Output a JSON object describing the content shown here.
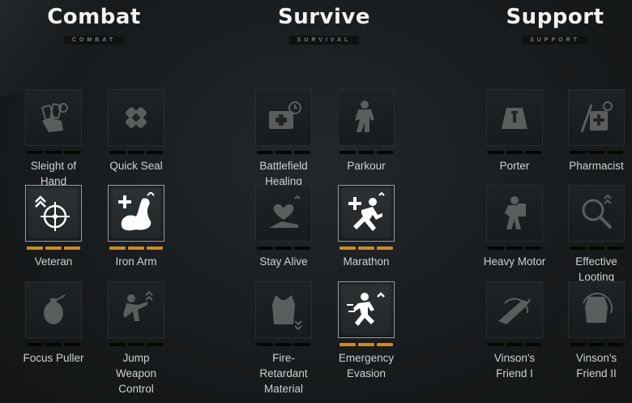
{
  "columns": [
    {
      "title": "Combat",
      "subtitle": "COMBAT"
    },
    {
      "title": "Survive",
      "subtitle": "SURVIVAL"
    },
    {
      "title": "Support",
      "subtitle": "SUPPORT"
    }
  ],
  "colors": {
    "active_bar": "#c98a2e",
    "inactive_bar": "#050606"
  },
  "perks": {
    "sleight_of_hand": {
      "label": "Sleight of\nHand",
      "icon": "hand-cards-icon",
      "active": false
    },
    "quick_seal": {
      "label": "Quick Seal",
      "icon": "bandage-icon",
      "active": false
    },
    "veteran": {
      "label": "Veteran",
      "icon": "crosshair-chevrons-icon",
      "active": true
    },
    "iron_arm": {
      "label": "Iron Arm",
      "icon": "flexed-arm-icon",
      "active": true
    },
    "focus_puller": {
      "label": "Focus Puller",
      "icon": "grenade-hand-icon",
      "active": false
    },
    "jump_weapon_control": {
      "label": "Jump\nWeapon\nControl",
      "icon": "jumping-soldier-icon",
      "active": false
    },
    "battlefield_healing": {
      "label": "Battlefield\nHealing",
      "icon": "medkit-timer-icon",
      "active": false
    },
    "parkour": {
      "label": "Parkour",
      "icon": "climbing-soldier-icon",
      "active": false
    },
    "stay_alive": {
      "label": "Stay Alive",
      "icon": "wounded-heart-icon",
      "active": false
    },
    "marathon": {
      "label": "Marathon",
      "icon": "running-man-icon",
      "active": true
    },
    "fire_retardant_material": {
      "label": "Fire-\nRetardant\nMaterial",
      "icon": "vest-icon",
      "active": false
    },
    "emergency_evasion": {
      "label": "Emergency\nEvasion",
      "icon": "sprinting-man-icon",
      "active": true
    },
    "porter": {
      "label": "Porter",
      "icon": "weight-icon",
      "active": false
    },
    "pharmacist": {
      "label": "Pharmacist",
      "icon": "syringe-medbox-icon",
      "active": false
    },
    "heavy_motor": {
      "label": "Heavy Motor",
      "icon": "loaded-soldier-icon",
      "active": false
    },
    "effective_looting": {
      "label": "Effective\nLooting",
      "icon": "magnifier-icon",
      "active": false
    },
    "vinsons_friend_1": {
      "label": "Vinson's\nFriend I",
      "icon": "rifle-icon",
      "active": false
    },
    "vinsons_friend_2": {
      "label": "Vinson's\nFriend II",
      "icon": "armor-icon",
      "active": false
    }
  }
}
